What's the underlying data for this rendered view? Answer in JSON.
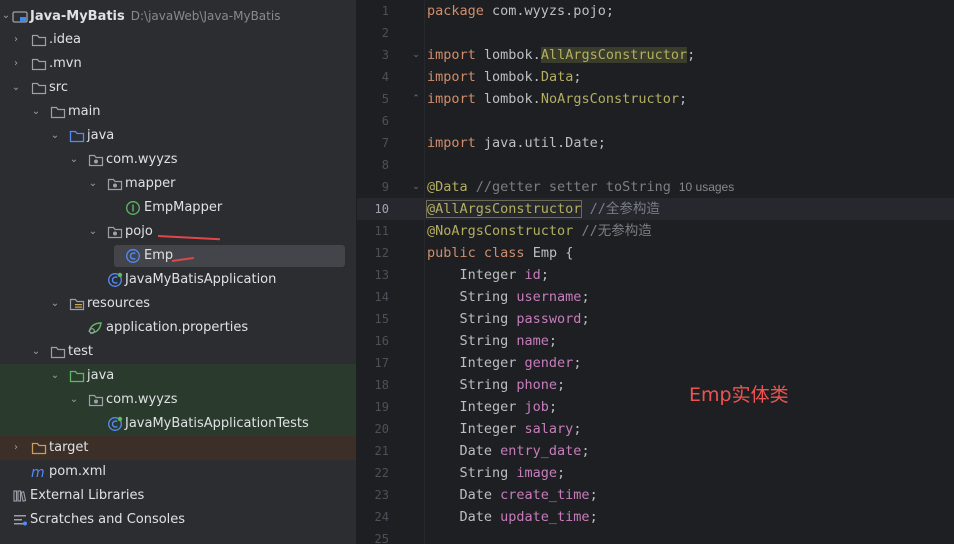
{
  "project_tree": {
    "root": {
      "name": "Java-MyBatis",
      "path": "D:\\javaWeb\\Java-MyBatis"
    },
    "items": [
      {
        "label": ".idea"
      },
      {
        "label": ".mvn"
      },
      {
        "label": "src"
      },
      {
        "label": "main"
      },
      {
        "label": "java"
      },
      {
        "label": "com.wyyzs"
      },
      {
        "label": "mapper"
      },
      {
        "label": "EmpMapper"
      },
      {
        "label": "pojo"
      },
      {
        "label": "Emp"
      },
      {
        "label": "JavaMyBatisApplication"
      },
      {
        "label": "resources"
      },
      {
        "label": "application.properties"
      },
      {
        "label": "test"
      },
      {
        "label": "java"
      },
      {
        "label": "com.wyyzs"
      },
      {
        "label": "JavaMyBatisApplicationTests"
      },
      {
        "label": "target"
      },
      {
        "label": "pom.xml"
      },
      {
        "label": "External Libraries"
      },
      {
        "label": "Scratches and Consoles"
      }
    ]
  },
  "editor": {
    "file": "Emp.java",
    "current_line": 10,
    "line_numbers": [
      "1",
      "2",
      "3",
      "4",
      "5",
      "6",
      "7",
      "8",
      "9",
      "10",
      "11",
      "12",
      "13",
      "14",
      "15",
      "16",
      "17",
      "18",
      "19",
      "20",
      "21",
      "22",
      "23",
      "24",
      "25"
    ],
    "code": {
      "l1_kw": "package",
      "l1_rest": " com.wyyzs.pojo;",
      "l3_kw": "import",
      "l3_pkg": " lombok.",
      "l3_cls": "AllArgsConstructor",
      "l3_end": ";",
      "l4_kw": "import",
      "l4_pkg": " lombok.",
      "l4_cls": "Data",
      "l4_end": ";",
      "l5_kw": "import",
      "l5_pkg": " lombok.",
      "l5_cls": "NoArgsConstructor",
      "l5_end": ";",
      "l7_kw": "import",
      "l7_rest": " java.util.Date;",
      "l9_ann": "@Data",
      "l9_cmt": " //getter setter toString",
      "l9_hint": "10 usages",
      "l10_ann": "@AllArgsConstructor",
      "l10_cmt": " //全参构造",
      "l11_ann": "@NoArgsConstructor",
      "l11_cmt": " //无参构造",
      "l12_kw1": "public",
      "l12_kw2": " class",
      "l12_rest": " Emp {",
      "fields": [
        {
          "type": "    Integer ",
          "name": "id"
        },
        {
          "type": "    String ",
          "name": "username"
        },
        {
          "type": "    String ",
          "name": "password"
        },
        {
          "type": "    String ",
          "name": "name"
        },
        {
          "type": "    Integer ",
          "name": "gender"
        },
        {
          "type": "    String ",
          "name": "phone"
        },
        {
          "type": "    Integer ",
          "name": "job"
        },
        {
          "type": "    Integer ",
          "name": "salary"
        },
        {
          "type": "    Date ",
          "name": "entry_date"
        },
        {
          "type": "    String ",
          "name": "image"
        },
        {
          "type": "    Date ",
          "name": "create_time"
        },
        {
          "type": "    Date ",
          "name": "update_time"
        }
      ],
      "semicolon": ";"
    },
    "annotation_note": "Emp实体类"
  },
  "colors": {
    "keyword": "#cf8e6d",
    "annotation": "#b3ae60",
    "field": "#c77dbb",
    "comment": "#7a7e85",
    "note": "#ef5350"
  }
}
